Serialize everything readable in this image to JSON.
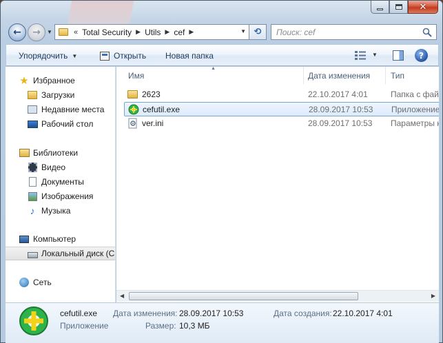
{
  "window": {
    "caption_buttons": {
      "minimize": "minimize",
      "maximize": "maximize",
      "close": "✕"
    }
  },
  "nav": {
    "back_glyph": "←",
    "forward_glyph": "→",
    "address": {
      "chevron": "«",
      "crumbs": [
        "Total Security",
        "Utils",
        "cef"
      ]
    },
    "search_placeholder": "Поиск: cef"
  },
  "commandbar": {
    "organize": "Упорядочить",
    "open": "Открыть",
    "new_folder": "Новая папка",
    "help": "?"
  },
  "sidebar": {
    "favorites": {
      "label": "Избранное",
      "items": [
        "Загрузки",
        "Недавние места",
        "Рабочий стол"
      ]
    },
    "libraries": {
      "label": "Библиотеки",
      "items": [
        "Видео",
        "Документы",
        "Изображения",
        "Музыка"
      ]
    },
    "computer": {
      "label": "Компьютер",
      "items": [
        "Локальный диск (C"
      ]
    },
    "network": {
      "label": "Сеть"
    }
  },
  "filelist": {
    "columns": {
      "name": "Имя",
      "date": "Дата изменения",
      "type": "Тип"
    },
    "rows": [
      {
        "name": "2623",
        "date": "22.10.2017 4:01",
        "type": "Папка с файлами",
        "icon": "folder-icon"
      },
      {
        "name": "cefutil.exe",
        "date": "28.09.2017 10:53",
        "type": "Приложение",
        "icon": "app-icon"
      },
      {
        "name": "ver.ini",
        "date": "28.09.2017 10:53",
        "type": "Параметры конфигурации",
        "icon": "config-file-icon"
      }
    ]
  },
  "details": {
    "name": "cefutil.exe",
    "kind": "Приложение",
    "modified_label": "Дата изменения:",
    "modified_value": "28.09.2017 10:53",
    "size_label": "Размер:",
    "size_value": "10,3 МБ",
    "created_label": "Дата создания:",
    "created_value": "22.10.2017 4:01"
  },
  "colors": {
    "accent": "#2456a7",
    "app_icon_green": "#2db34a",
    "app_icon_yellow": "#f2d21b"
  }
}
